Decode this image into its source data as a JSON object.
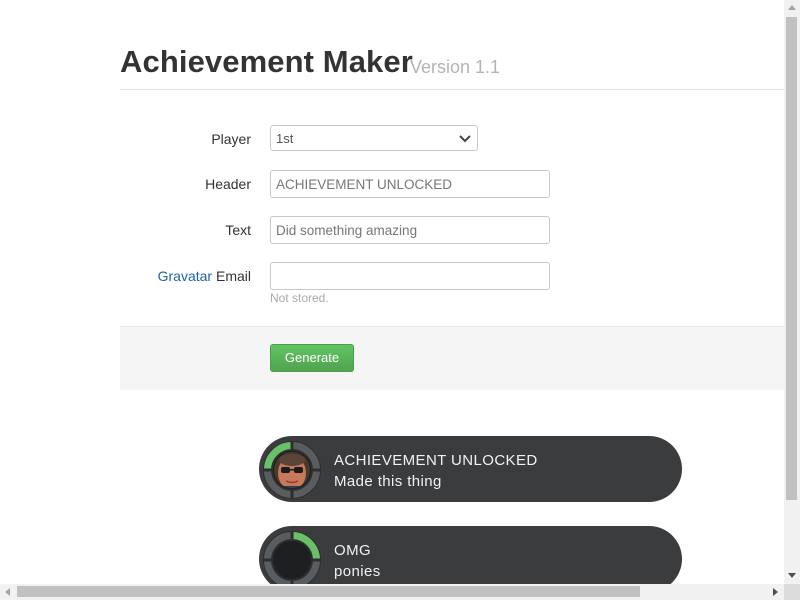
{
  "header": {
    "title": "Achievement Maker",
    "version": "Version 1.1"
  },
  "form": {
    "player": {
      "label": "Player",
      "selected": "1st"
    },
    "header_field": {
      "label": "Header",
      "placeholder": "ACHIEVEMENT UNLOCKED"
    },
    "text_field": {
      "label": "Text",
      "placeholder": "Did something amazing"
    },
    "email_field": {
      "label_link": "Gravatar",
      "label_rest": " Email",
      "value": "",
      "help": "Not stored."
    }
  },
  "actions": {
    "generate_label": "Generate"
  },
  "achievements": [
    {
      "title": "ACHIEVEMENT UNLOCKED",
      "text": "Made this thing",
      "progress": 0.25,
      "has_avatar": true
    },
    {
      "title": "OMG",
      "text": "ponies",
      "progress": 0.25,
      "has_avatar": false
    }
  ],
  "colors": {
    "accent_green": "#5cb85c",
    "ring_green": "#6abf69",
    "badge_bg": "#3a3c3d",
    "link_blue": "#1f63a8"
  }
}
